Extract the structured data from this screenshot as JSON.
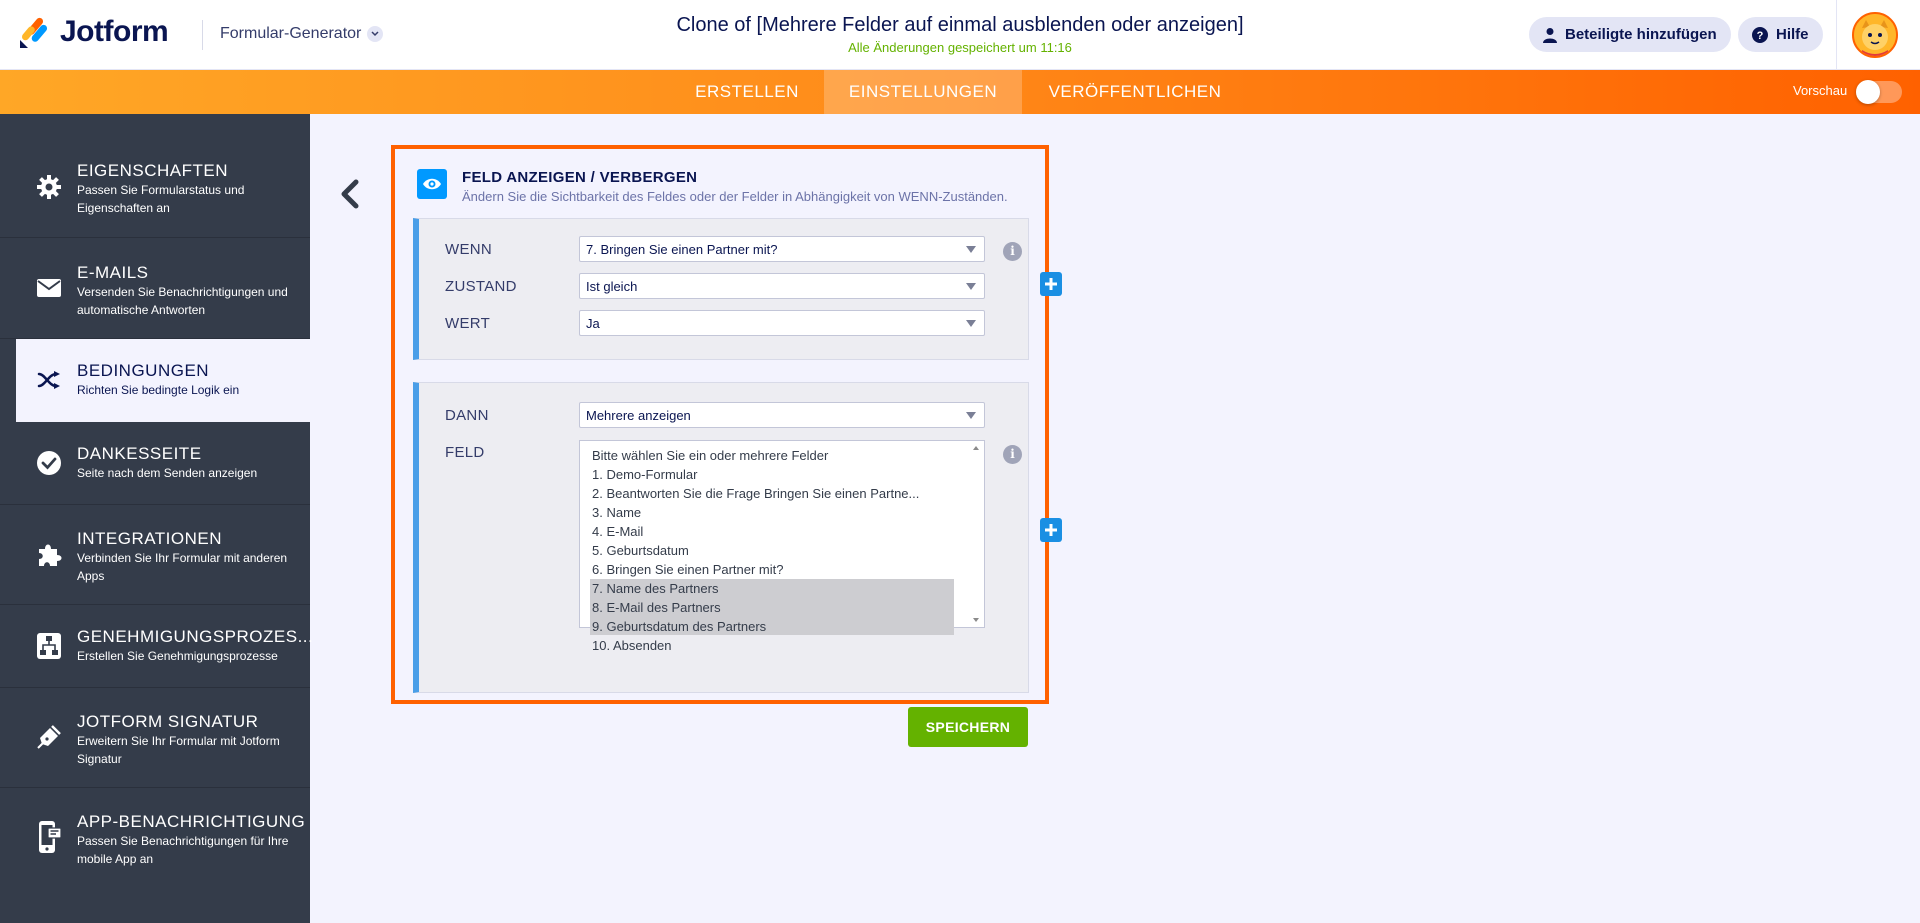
{
  "header": {
    "logo_text": "Jotform",
    "builder_label": "Formular-Generator",
    "form_title": "Clone of [Mehrere Felder auf einmal ausblenden oder anzeigen]",
    "saved_status": "Alle Änderungen gespeichert um 11:16",
    "add_participants_label": "Beteiligte hinzufügen",
    "help_label": "Hilfe"
  },
  "navbar": {
    "tabs": [
      {
        "label": "ERSTELLEN"
      },
      {
        "label": "EINSTELLUNGEN",
        "active": true
      },
      {
        "label": "VERÖFFENTLICHEN"
      }
    ],
    "preview_label": "Vorschau",
    "preview_on": false
  },
  "sidebar": {
    "items": [
      {
        "title": "EIGENSCHAFTEN",
        "desc": "Passen Sie Formularstatus und Eigenschaften an",
        "icon": "gear-icon"
      },
      {
        "title": "E-MAILS",
        "desc": "Versenden Sie Benachrichtigungen und automatische Antworten",
        "icon": "envelope-icon"
      },
      {
        "title": "BEDINGUNGEN",
        "desc": "Richten Sie bedingte Logik ein",
        "icon": "shuffle-icon",
        "active": true
      },
      {
        "title": "DANKESSEITE",
        "desc": "Seite nach dem Senden anzeigen",
        "icon": "check-circle-icon"
      },
      {
        "title": "INTEGRATIONEN",
        "desc": "Verbinden Sie Ihr Formular mit anderen Apps",
        "icon": "puzzle-icon"
      },
      {
        "title": "GENEHMIGUNGSPROZES...",
        "desc": "Erstellen Sie Genehmigungsprozesse",
        "icon": "flowchart-icon"
      },
      {
        "title": "JOTFORM SIGNATUR",
        "desc": "Erweitern Sie Ihr Formular mit Jotform Signatur",
        "icon": "pen-icon"
      },
      {
        "title": "APP-BENACHRICHTIGUNG",
        "desc": "Passen Sie Benachrichtigungen für Ihre mobile App an",
        "icon": "mobile-icon"
      }
    ]
  },
  "condition": {
    "title": "FELD ANZEIGEN / VERBERGEN",
    "subtitle": "Ändern Sie die Sichtbarkeit des Feldes oder der Felder in Abhängigkeit von WENN-Zuständen.",
    "if_block": {
      "wenn_label": "WENN",
      "wenn_value": "7. Bringen Sie einen Partner mit?",
      "zustand_label": "ZUSTAND",
      "zustand_value": "Ist gleich",
      "wert_label": "WERT",
      "wert_value": "Ja"
    },
    "then_block": {
      "dann_label": "DANN",
      "dann_value": "Mehrere anzeigen",
      "feld_label": "FELD",
      "options": [
        {
          "label": "Bitte wählen Sie ein oder mehrere Felder",
          "selected": false
        },
        {
          "label": "1. Demo-Formular",
          "selected": false
        },
        {
          "label": "2. Beantworten Sie die Frage Bringen Sie einen Partne...",
          "selected": false
        },
        {
          "label": "3. Name",
          "selected": false
        },
        {
          "label": "4. E-Mail",
          "selected": false
        },
        {
          "label": "5. Geburtsdatum",
          "selected": false
        },
        {
          "label": "6. Bringen Sie einen Partner mit?",
          "selected": false
        },
        {
          "label": "7. Name des Partners",
          "selected": true
        },
        {
          "label": "8. E-Mail des Partners",
          "selected": true
        },
        {
          "label": "9. Geburtsdatum des Partners",
          "selected": true
        },
        {
          "label": "10. Absenden",
          "selected": false
        }
      ]
    },
    "info_symbol": "i",
    "save_label": "SPEICHERN"
  },
  "colors": {
    "accent_orange": "#ff6100",
    "sidebar_bg": "#343c4a",
    "primary_blue": "#0099ff",
    "save_green": "#64b200"
  }
}
